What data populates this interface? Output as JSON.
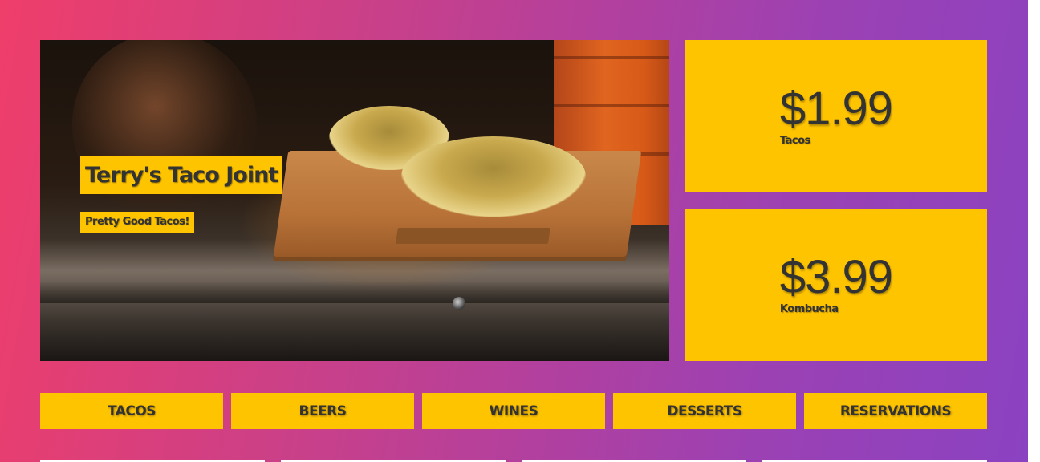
{
  "hero": {
    "title": "Terry's Taco Joint",
    "subtitle": "Pretty Good Tacos!"
  },
  "prices": [
    {
      "amount": "$1.99",
      "label": "Tacos"
    },
    {
      "amount": "$3.99",
      "label": "Kombucha"
    }
  ],
  "nav": {
    "items": [
      "TACOS",
      "BEERS",
      "WINES",
      "DESSERTS",
      "RESERVATIONS"
    ]
  },
  "colors": {
    "accent": "#ffc400",
    "gradient_start": "#ef3e6a",
    "gradient_end": "#8a42c2",
    "text": "#333333"
  }
}
